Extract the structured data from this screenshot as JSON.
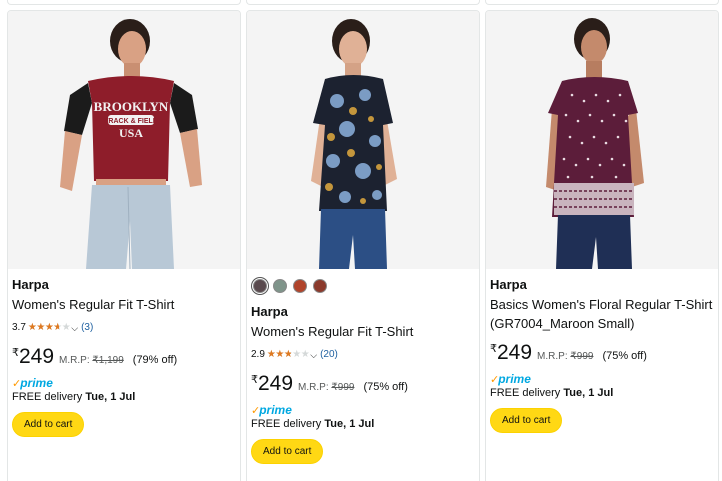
{
  "accent": {
    "cart_button": "#ffd814",
    "star": "#de7921",
    "link": "#2162a1",
    "prime": "#00a8e1"
  },
  "products": [
    {
      "brand": "Harpa",
      "title_line1": "Women's Regular Fit T-Shirt",
      "title_line2": "",
      "rating_value": "3.7",
      "rating_stars": 3.7,
      "rating_count": "(3)",
      "currency": "₹",
      "price": "249",
      "mrp_label": "M.R.P:",
      "mrp_value": "₹1,199",
      "discount": "(79% off)",
      "prime_label": "prime",
      "delivery_text": "FREE delivery",
      "delivery_date": "Tue, 1 Jul",
      "cart_label": "Add to cart",
      "image_icon": "maroon-brooklyn-tshirt-image",
      "image_text": [
        "BROOKLYN",
        "TRACK & FIELD",
        "USA"
      ]
    },
    {
      "brand": "Harpa",
      "title_line1": "Women's Regular Fit T-Shirt",
      "title_line2": "",
      "swatches": [
        "#5a4a4e",
        "#7f948a",
        "#b0442b",
        "#8b3a2c"
      ],
      "rating_value": "2.9",
      "rating_stars": 2.9,
      "rating_count": "(20)",
      "currency": "₹",
      "price": "249",
      "mrp_label": "M.R.P:",
      "mrp_value": "₹999",
      "discount": "(75% off)",
      "prime_label": "prime",
      "delivery_text": "FREE delivery",
      "delivery_date": "Tue, 1 Jul",
      "cart_label": "Add to cart",
      "image_icon": "floral-top-image"
    },
    {
      "brand": "Harpa",
      "title_line1": "Basics Women's Floral Regular T-Shirt",
      "title_line2": "(GR7004_Maroon Small)",
      "currency": "₹",
      "price": "249",
      "mrp_label": "M.R.P:",
      "mrp_value": "₹999",
      "discount": "(75% off)",
      "prime_label": "prime",
      "delivery_text": "FREE delivery",
      "delivery_date": "Tue, 1 Jul",
      "cart_label": "Add to cart",
      "image_icon": "maroon-polka-top-image"
    }
  ]
}
